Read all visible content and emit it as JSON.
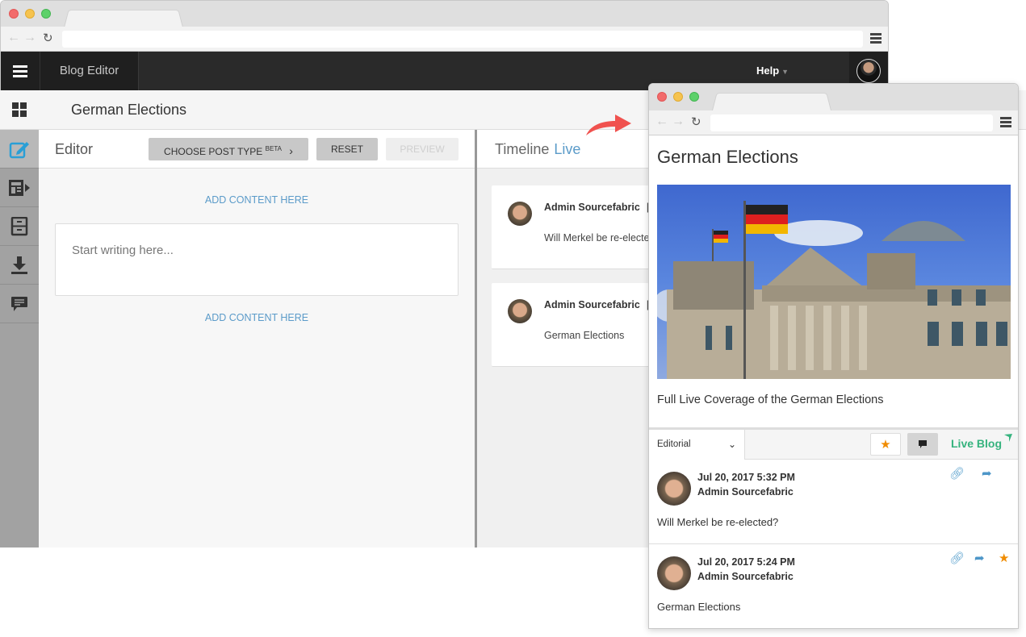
{
  "back_browser": {
    "app": {
      "title": "Blog Editor",
      "help_label": "Help"
    },
    "blog_title": "German Elections",
    "sidebar": {
      "items": [
        {
          "icon": "dashboard-icon"
        },
        {
          "icon": "edit-icon",
          "active": true
        },
        {
          "icon": "posts-icon"
        },
        {
          "icon": "archive-icon"
        },
        {
          "icon": "download-icon"
        },
        {
          "icon": "comments-icon"
        }
      ]
    },
    "editor": {
      "title": "Editor",
      "choose_post_type": "CHOOSE POST TYPE",
      "beta": "BETA",
      "reset": "RESET",
      "preview": "PREVIEW",
      "add_content_top": "ADD CONTENT HERE",
      "add_content_bottom": "ADD CONTENT HERE",
      "placeholder": "Start writing here..."
    },
    "timeline": {
      "title": "Timeline",
      "live": "Live",
      "posts": [
        {
          "author": "Admin Sourcefabric",
          "sep": "|",
          "text": "Will Merkel be re-elected?"
        },
        {
          "author": "Admin Sourcefabric",
          "sep": "|",
          "text": "German Elections"
        }
      ]
    }
  },
  "front_browser": {
    "title": "German Elections",
    "image_alt": "Reichstag building with German flags",
    "description": "Full Live Coverage of the German Elections",
    "toolbar": {
      "filter_selected": "Editorial",
      "brand": "Live Blog"
    },
    "posts": [
      {
        "date": "Jul 20, 2017 5:32 PM",
        "author": "Admin Sourcefabric",
        "text": "Will Merkel be re-elected?",
        "highlighted": false
      },
      {
        "date": "Jul 20, 2017 5:24 PM",
        "author": "Admin Sourcefabric",
        "text": "German Elections",
        "highlighted": true
      }
    ]
  },
  "colors": {
    "accent_blue": "#5b9bc9",
    "live_blog_green": "#36b37e",
    "star_orange": "#f08c00",
    "arrow_red": "#f0524f"
  }
}
